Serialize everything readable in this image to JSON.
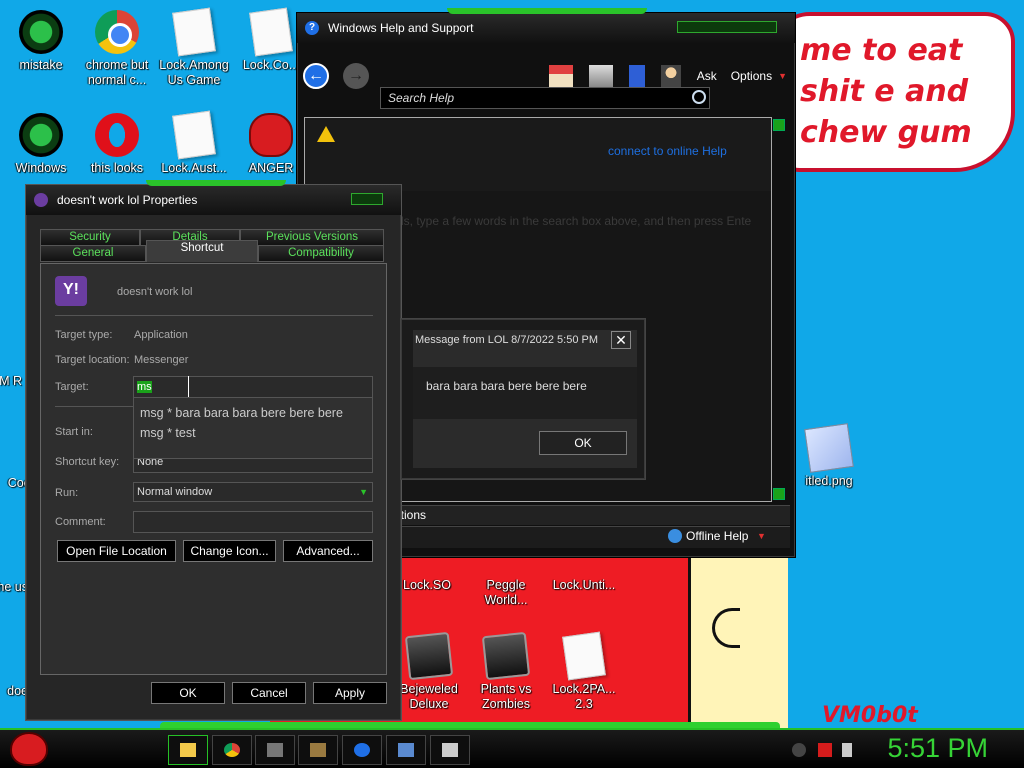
{
  "desktop": {
    "icons": [
      {
        "label": "mistake",
        "icon": "green-app-icon"
      },
      {
        "label": "chrome but normal c...",
        "icon": "chrome-icon"
      },
      {
        "label": "Lock.Among Us Game",
        "icon": "document-icon"
      },
      {
        "label": "Lock.Co...",
        "icon": "document-icon"
      },
      {
        "label": "Windows",
        "icon": "green-app-icon"
      },
      {
        "label": "this looks",
        "icon": "opera-icon"
      },
      {
        "label": "Lock.Aust...",
        "icon": "document-icon"
      },
      {
        "label": "ANGER",
        "icon": "angry-bird-icon"
      },
      {
        "label": "Lock.SO",
        "icon": "document-icon"
      },
      {
        "label": "Peggle World...",
        "icon": "app-icon"
      },
      {
        "label": "Lock.Unti...",
        "icon": "document-icon"
      },
      {
        "label": "Bejeweled Deluxe",
        "icon": "app-icon"
      },
      {
        "label": "Plants vs Zombies",
        "icon": "app-icon"
      },
      {
        "label": "Lock.2PA... 2.3",
        "icon": "document-icon"
      },
      {
        "label": "itled.png",
        "icon": "image-icon"
      },
      {
        "label": "Coc",
        "icon": "app-icon"
      },
      {
        "label": "whe us",
        "icon": "app-icon"
      },
      {
        "label": "doe",
        "icon": "app-icon"
      },
      {
        "label": "M R",
        "icon": "app-icon"
      }
    ],
    "wallpaper_text": "me to eat shit e and chew gum",
    "wallpaper_signature": "VM0b0t"
  },
  "help_window": {
    "title": "Windows Help and Support",
    "toolbar": {
      "ask": "Ask",
      "options": "Options"
    },
    "search_placeholder": "Search Help",
    "online_link": "connect to online Help",
    "faded_text": "ls, type a few words in the search box above, and then press Ente",
    "bottom_bar": "ptions",
    "status": "Offline Help"
  },
  "properties": {
    "title": "doesn't work lol Properties",
    "tabs_row1": [
      "Security",
      "Details",
      "Previous Versions"
    ],
    "tabs_row2": [
      "General",
      "Shortcut",
      "Compatibility"
    ],
    "name": "doesn't work lol",
    "target_type_label": "Target type:",
    "target_type": "Application",
    "target_location_label": "Target location:",
    "target_location": "Messenger",
    "target_label": "Target:",
    "target_value": "ms",
    "autocomplete": [
      "msg * bara bara bara bere bere bere",
      "msg * test"
    ],
    "start_in_label": "Start in:",
    "shortcut_key_label": "Shortcut key:",
    "shortcut_key": "None",
    "run_label": "Run:",
    "run_value": "Normal window",
    "comment_label": "Comment:",
    "buttons": {
      "open_location": "Open File Location",
      "change_icon": "Change Icon...",
      "advanced": "Advanced...",
      "ok": "OK",
      "cancel": "Cancel",
      "apply": "Apply"
    }
  },
  "message": {
    "title": "Message from LOL 8/7/2022 5:50 PM",
    "body": "bara bara bara bere bere bere",
    "ok": "OK",
    "close": "✕"
  },
  "taskbar": {
    "clock": "5:51 PM"
  },
  "colors": {
    "accent": "#2ac32a",
    "link": "#1e6fe0",
    "wallpaper": "#10a8e8"
  }
}
